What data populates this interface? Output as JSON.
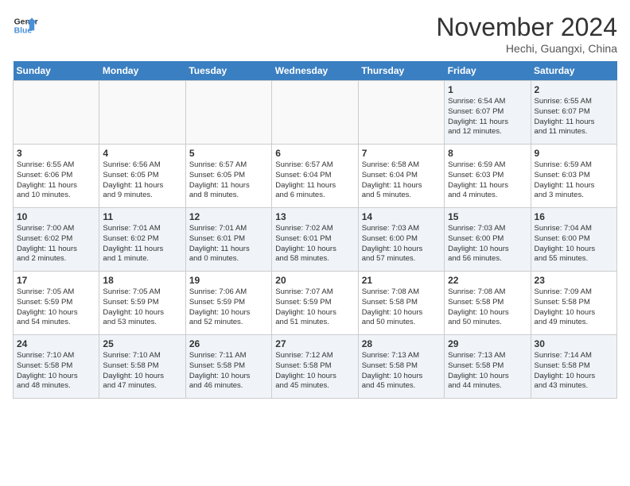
{
  "header": {
    "logo_general": "General",
    "logo_blue": "Blue",
    "month_title": "November 2024",
    "location": "Hechi, Guangxi, China"
  },
  "weekdays": [
    "Sunday",
    "Monday",
    "Tuesday",
    "Wednesday",
    "Thursday",
    "Friday",
    "Saturday"
  ],
  "weeks": [
    [
      {
        "day": "",
        "info": ""
      },
      {
        "day": "",
        "info": ""
      },
      {
        "day": "",
        "info": ""
      },
      {
        "day": "",
        "info": ""
      },
      {
        "day": "",
        "info": ""
      },
      {
        "day": "1",
        "info": "Sunrise: 6:54 AM\nSunset: 6:07 PM\nDaylight: 11 hours\nand 12 minutes."
      },
      {
        "day": "2",
        "info": "Sunrise: 6:55 AM\nSunset: 6:07 PM\nDaylight: 11 hours\nand 11 minutes."
      }
    ],
    [
      {
        "day": "3",
        "info": "Sunrise: 6:55 AM\nSunset: 6:06 PM\nDaylight: 11 hours\nand 10 minutes."
      },
      {
        "day": "4",
        "info": "Sunrise: 6:56 AM\nSunset: 6:05 PM\nDaylight: 11 hours\nand 9 minutes."
      },
      {
        "day": "5",
        "info": "Sunrise: 6:57 AM\nSunset: 6:05 PM\nDaylight: 11 hours\nand 8 minutes."
      },
      {
        "day": "6",
        "info": "Sunrise: 6:57 AM\nSunset: 6:04 PM\nDaylight: 11 hours\nand 6 minutes."
      },
      {
        "day": "7",
        "info": "Sunrise: 6:58 AM\nSunset: 6:04 PM\nDaylight: 11 hours\nand 5 minutes."
      },
      {
        "day": "8",
        "info": "Sunrise: 6:59 AM\nSunset: 6:03 PM\nDaylight: 11 hours\nand 4 minutes."
      },
      {
        "day": "9",
        "info": "Sunrise: 6:59 AM\nSunset: 6:03 PM\nDaylight: 11 hours\nand 3 minutes."
      }
    ],
    [
      {
        "day": "10",
        "info": "Sunrise: 7:00 AM\nSunset: 6:02 PM\nDaylight: 11 hours\nand 2 minutes."
      },
      {
        "day": "11",
        "info": "Sunrise: 7:01 AM\nSunset: 6:02 PM\nDaylight: 11 hours\nand 1 minute."
      },
      {
        "day": "12",
        "info": "Sunrise: 7:01 AM\nSunset: 6:01 PM\nDaylight: 11 hours\nand 0 minutes."
      },
      {
        "day": "13",
        "info": "Sunrise: 7:02 AM\nSunset: 6:01 PM\nDaylight: 10 hours\nand 58 minutes."
      },
      {
        "day": "14",
        "info": "Sunrise: 7:03 AM\nSunset: 6:00 PM\nDaylight: 10 hours\nand 57 minutes."
      },
      {
        "day": "15",
        "info": "Sunrise: 7:03 AM\nSunset: 6:00 PM\nDaylight: 10 hours\nand 56 minutes."
      },
      {
        "day": "16",
        "info": "Sunrise: 7:04 AM\nSunset: 6:00 PM\nDaylight: 10 hours\nand 55 minutes."
      }
    ],
    [
      {
        "day": "17",
        "info": "Sunrise: 7:05 AM\nSunset: 5:59 PM\nDaylight: 10 hours\nand 54 minutes."
      },
      {
        "day": "18",
        "info": "Sunrise: 7:05 AM\nSunset: 5:59 PM\nDaylight: 10 hours\nand 53 minutes."
      },
      {
        "day": "19",
        "info": "Sunrise: 7:06 AM\nSunset: 5:59 PM\nDaylight: 10 hours\nand 52 minutes."
      },
      {
        "day": "20",
        "info": "Sunrise: 7:07 AM\nSunset: 5:59 PM\nDaylight: 10 hours\nand 51 minutes."
      },
      {
        "day": "21",
        "info": "Sunrise: 7:08 AM\nSunset: 5:58 PM\nDaylight: 10 hours\nand 50 minutes."
      },
      {
        "day": "22",
        "info": "Sunrise: 7:08 AM\nSunset: 5:58 PM\nDaylight: 10 hours\nand 50 minutes."
      },
      {
        "day": "23",
        "info": "Sunrise: 7:09 AM\nSunset: 5:58 PM\nDaylight: 10 hours\nand 49 minutes."
      }
    ],
    [
      {
        "day": "24",
        "info": "Sunrise: 7:10 AM\nSunset: 5:58 PM\nDaylight: 10 hours\nand 48 minutes."
      },
      {
        "day": "25",
        "info": "Sunrise: 7:10 AM\nSunset: 5:58 PM\nDaylight: 10 hours\nand 47 minutes."
      },
      {
        "day": "26",
        "info": "Sunrise: 7:11 AM\nSunset: 5:58 PM\nDaylight: 10 hours\nand 46 minutes."
      },
      {
        "day": "27",
        "info": "Sunrise: 7:12 AM\nSunset: 5:58 PM\nDaylight: 10 hours\nand 45 minutes."
      },
      {
        "day": "28",
        "info": "Sunrise: 7:13 AM\nSunset: 5:58 PM\nDaylight: 10 hours\nand 45 minutes."
      },
      {
        "day": "29",
        "info": "Sunrise: 7:13 AM\nSunset: 5:58 PM\nDaylight: 10 hours\nand 44 minutes."
      },
      {
        "day": "30",
        "info": "Sunrise: 7:14 AM\nSunset: 5:58 PM\nDaylight: 10 hours\nand 43 minutes."
      }
    ]
  ]
}
